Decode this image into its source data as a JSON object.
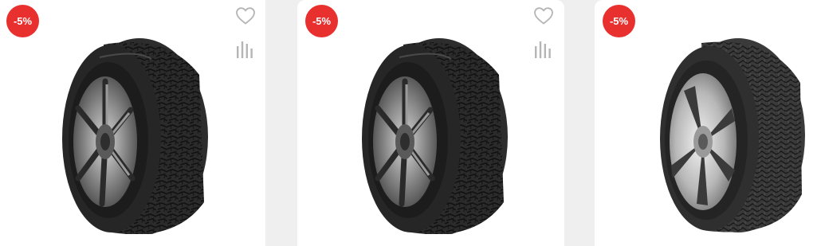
{
  "products": [
    {
      "discount_badge": "-5%",
      "favorite_icon": "heart-outline-icon",
      "compare_icon": "compare-bars-icon",
      "image_alt": "tire-image"
    },
    {
      "discount_badge": "-5%",
      "favorite_icon": "heart-outline-icon",
      "compare_icon": "compare-bars-icon",
      "image_alt": "tire-image"
    },
    {
      "discount_badge": "-5%",
      "image_alt": "tire-image"
    }
  ],
  "colors": {
    "badge": "#e8312f",
    "icon": "#b5b5b5",
    "background": "#efefef",
    "card": "#ffffff"
  }
}
